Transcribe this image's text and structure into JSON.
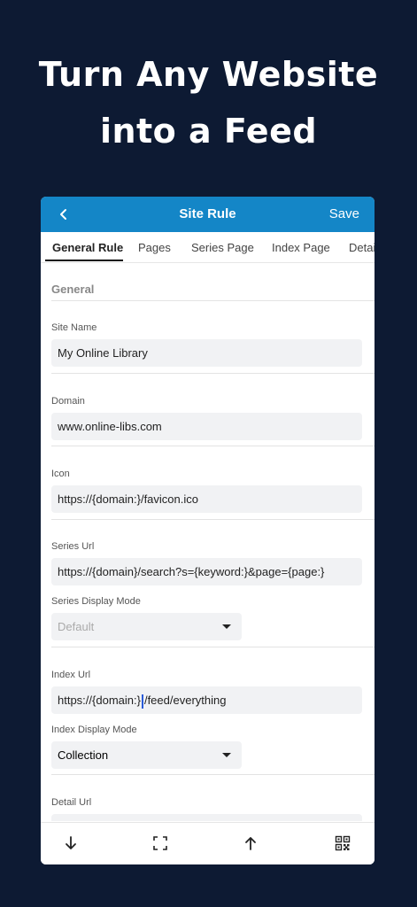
{
  "promo": {
    "line1": "Turn Any Website",
    "line2": "into a Feed"
  },
  "appbar": {
    "title": "Site Rule",
    "save_label": "Save",
    "back_icon": "chevron-left-icon"
  },
  "tabs": [
    {
      "label": "General Rule",
      "active": true
    },
    {
      "label": "Pages",
      "active": false
    },
    {
      "label": "Series Page",
      "active": false
    },
    {
      "label": "Index Page",
      "active": false
    },
    {
      "label": "Detai",
      "active": false
    }
  ],
  "section": {
    "title": "General"
  },
  "fields": {
    "site_name": {
      "label": "Site Name",
      "value": "My Online Library"
    },
    "domain": {
      "label": "Domain",
      "value": "www.online-libs.com"
    },
    "icon": {
      "label": "Icon",
      "value": "https://{domain:}/favicon.ico"
    },
    "series_url": {
      "label": "Series Url",
      "value": "https://{domain}/search?s={keyword:}&page={page:}"
    },
    "series_display_mode": {
      "label": "Series Display Mode",
      "value": "Default"
    },
    "index_url": {
      "label": "Index Url",
      "value_before_cursor": "https://{domain:}",
      "value_after_cursor": "/feed/everything"
    },
    "index_display_mode": {
      "label": "Index Display Mode",
      "value": "Collection"
    },
    "detail_url": {
      "label": "Detail Url"
    }
  },
  "bottombar": {
    "icons": [
      "arrow-down-icon",
      "expand-icon",
      "arrow-up-icon",
      "qr-code-icon"
    ]
  },
  "colors": {
    "background": "#0d1a33",
    "appbar": "#1486c7",
    "field_bg": "#f1f2f4"
  }
}
